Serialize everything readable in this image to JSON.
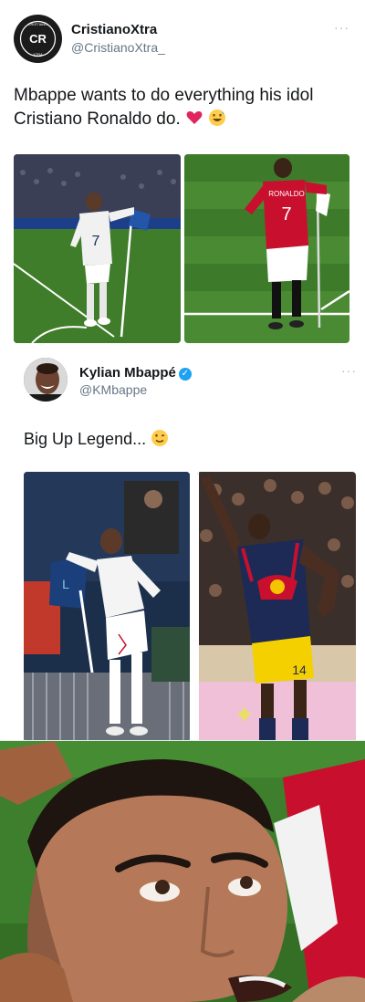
{
  "tweet1": {
    "display_name": "CristianoXtra",
    "handle": "@CristianoXtra_",
    "more_label": "···",
    "text": "Mbappe wants to do everything his idol Cristiano Ronaldo do.",
    "emojis": [
      "red-heart",
      "grinning-sweat"
    ],
    "photos": [
      {
        "name": "mbappe-corner-flag-photo",
        "shirt_number": "7"
      },
      {
        "name": "ronaldo-corner-flag-photo",
        "shirt_text": "RONALDO",
        "shirt_number": "7"
      }
    ]
  },
  "tweet2": {
    "display_name": "Kylian Mbappé",
    "handle": "@KMbappe",
    "more_label": "···",
    "text": "Big Up Legend...",
    "emojis": [
      "winking-face"
    ],
    "verified_mark": "✓",
    "photos": [
      {
        "name": "mbappe-celebration-photo"
      },
      {
        "name": "henry-corner-flag-photo",
        "shirt_number": "14"
      }
    ]
  },
  "meme": {
    "name": "ronaldo-reaction-closeup"
  },
  "colors": {
    "text": "#14171a",
    "secondary": "#657786",
    "verified": "#1da1f2",
    "pitch": "#3f7d2a",
    "united_red": "#c8102e"
  }
}
